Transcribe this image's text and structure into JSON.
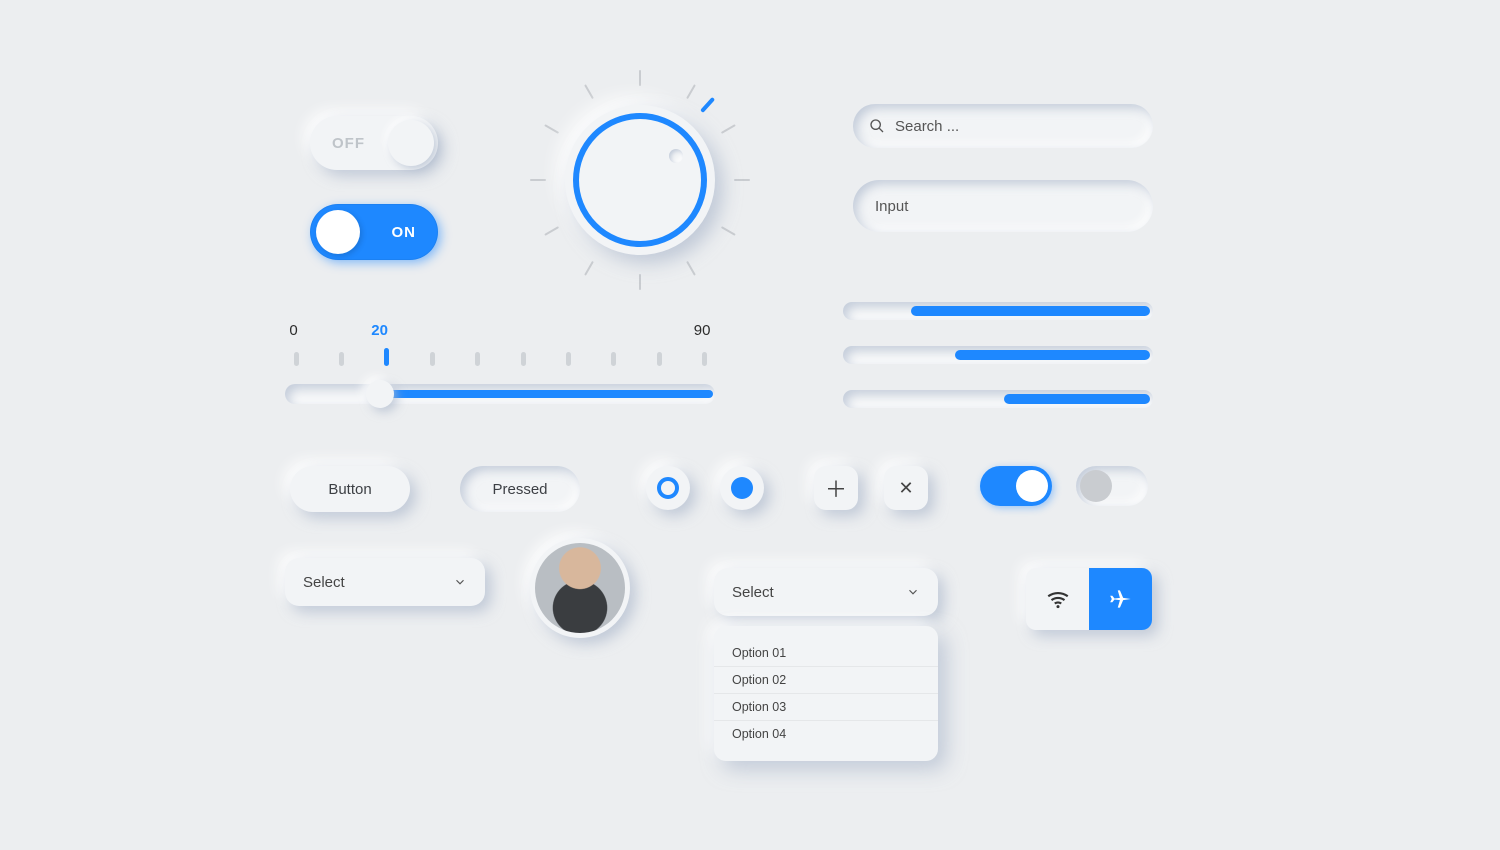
{
  "toggles": {
    "off_label": "OFF",
    "on_label": "ON"
  },
  "dial": {
    "ticks": 12,
    "angle_deg": 42
  },
  "search": {
    "placeholder": "Search ..."
  },
  "input": {
    "placeholder": "Input"
  },
  "ruler": {
    "min_label": "0",
    "value_label": "20",
    "max_label": "90",
    "tick_count": 10,
    "active_tick_index": 2,
    "value_pct": 22
  },
  "progress": [
    {
      "start_pct": 22,
      "end_pct": 99
    },
    {
      "start_pct": 36,
      "end_pct": 99
    },
    {
      "start_pct": 52,
      "end_pct": 99
    }
  ],
  "buttons": {
    "normal": "Button",
    "pressed": "Pressed"
  },
  "mini_toggle": {
    "on": true,
    "off": false
  },
  "select": {
    "label_1": "Select",
    "label_2": "Select",
    "options": [
      "Option 01",
      "Option 02",
      "Option 03",
      "Option 04"
    ]
  },
  "segmented": {
    "wifi_active": false,
    "airplane_active": true
  },
  "colors": {
    "accent": "#1e88ff",
    "bg": "#eceef0"
  }
}
